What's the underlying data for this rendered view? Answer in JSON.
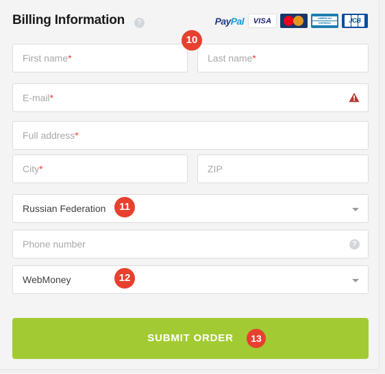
{
  "header": {
    "title": "Billing Information",
    "help_icon": "question-mark-circle-icon",
    "payment_badges": [
      {
        "name": "paypal",
        "label_a": "Pay",
        "label_b": "Pal"
      },
      {
        "name": "visa",
        "label": "VISA"
      },
      {
        "name": "mastercard",
        "label": ""
      },
      {
        "name": "american-express",
        "line1": "AMERICAN",
        "line2": "EXPRESS"
      },
      {
        "name": "jcb",
        "label": "JCB"
      }
    ]
  },
  "form": {
    "first_name": {
      "placeholder": "First name",
      "required": "*",
      "value": ""
    },
    "last_name": {
      "placeholder": "Last name",
      "required": "*",
      "value": ""
    },
    "email": {
      "placeholder": "E-mail",
      "required": "*",
      "value": "",
      "error_icon": "warning-triangle-icon"
    },
    "full_address": {
      "placeholder": "Full address",
      "required": "*",
      "value": ""
    },
    "city": {
      "placeholder": "City",
      "required": "*",
      "value": ""
    },
    "zip": {
      "placeholder": "ZIP",
      "required": "",
      "value": ""
    },
    "country": {
      "value": "Russian Federation",
      "caret": "chevron-down-icon"
    },
    "phone": {
      "placeholder": "Phone number",
      "value": "",
      "help_icon": "question-mark-circle-icon"
    },
    "payment_method": {
      "value": "WebMoney",
      "caret": "chevron-down-icon"
    }
  },
  "submit": {
    "label": "SUBMIT ORDER"
  },
  "annotations": {
    "step_10": "10",
    "step_11": "11",
    "step_12": "12",
    "step_13": "13"
  },
  "colors": {
    "accent_green": "#A2CB33",
    "badge_red": "#E8402F",
    "required_red": "#E8402F",
    "background": "#F4F4F4",
    "field_border": "#DCDCDC",
    "placeholder": "#A8A8A8"
  }
}
